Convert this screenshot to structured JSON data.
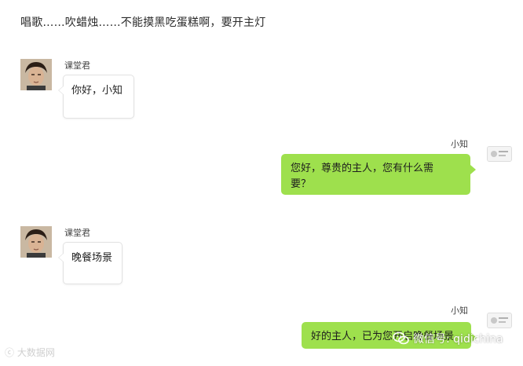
{
  "caption": "唱歌……吹蜡烛……不能摸黑吃蛋糕啊，要开主灯",
  "messages": [
    {
      "sender": "课堂君",
      "text": "你好，小知"
    },
    {
      "sender": "小知",
      "text_line1": "您好，尊贵的主人，您有什么需",
      "text_line2": "要？"
    },
    {
      "sender": "课堂君",
      "text": "晚餐场景"
    },
    {
      "sender": "小知",
      "text": "好的主人，已为您开启晚餐场景"
    }
  ],
  "watermark": {
    "left": "ⓒ 大数据网",
    "right": "微信号: qidichina"
  },
  "colors": {
    "outgoing_bubble": "#9ee04d",
    "incoming_bubble": "#ffffff",
    "background": "#ffffff"
  },
  "icons": {
    "user_avatar": "face-portrait-icon",
    "bot_avatar": "small-device-icon",
    "wechat": "wechat-icon"
  }
}
